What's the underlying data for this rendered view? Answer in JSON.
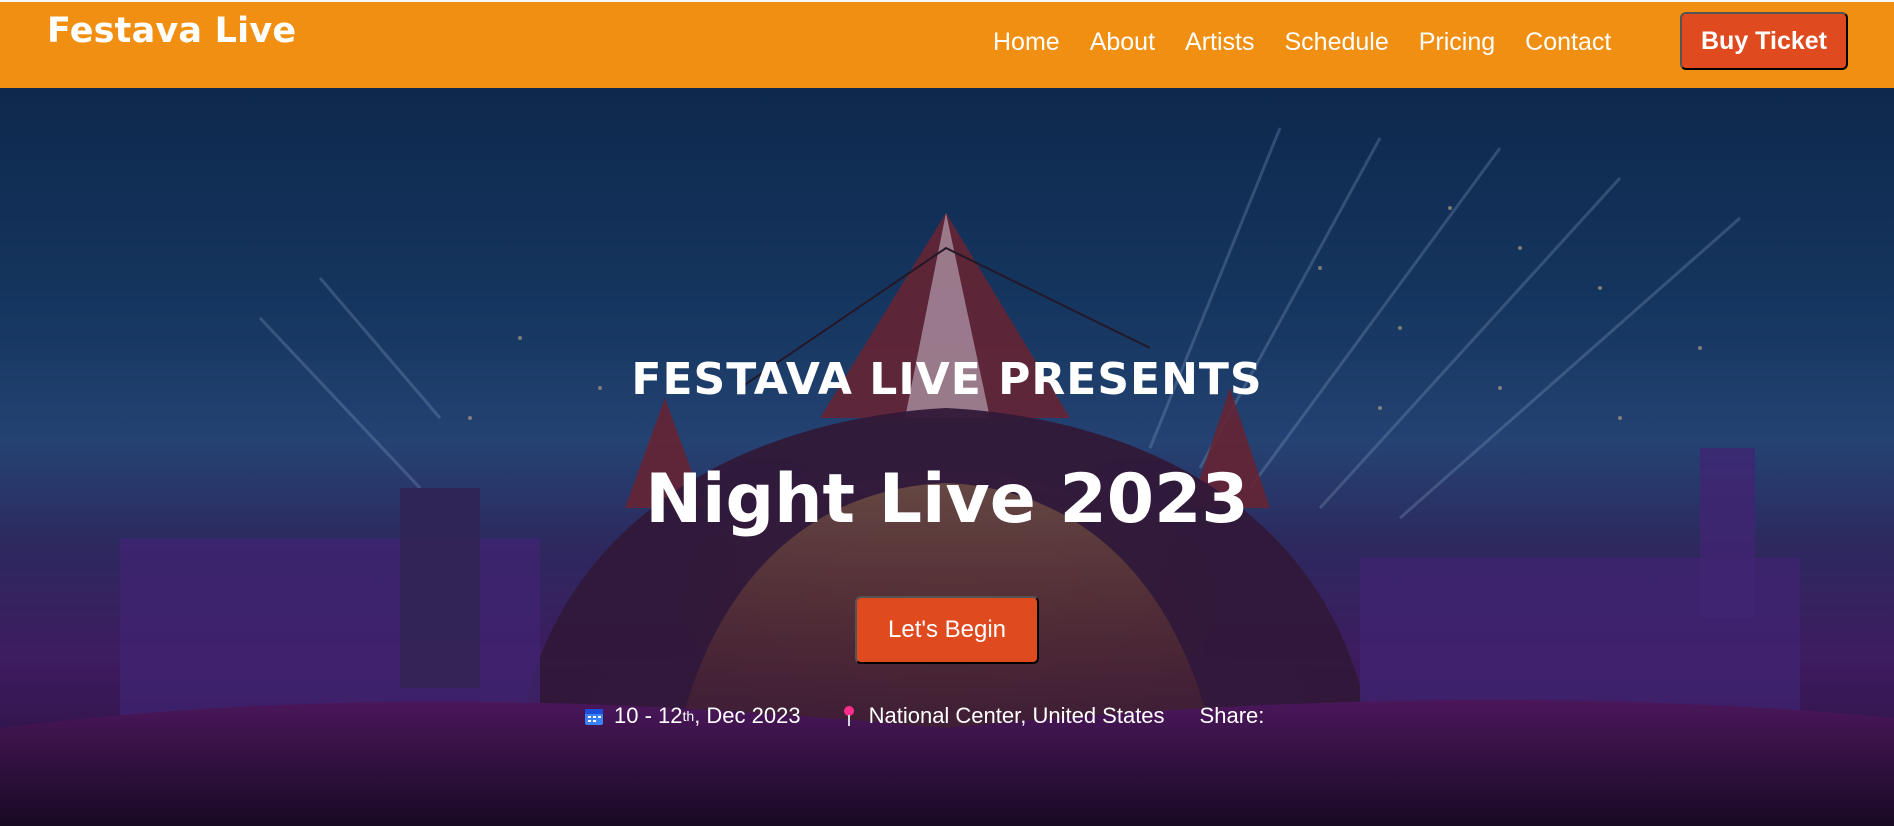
{
  "brand": {
    "name": "Festava Live"
  },
  "nav": {
    "items": [
      "Home",
      "About",
      "Artists",
      "Schedule",
      "Pricing",
      "Contact"
    ],
    "cta_label": "Buy Ticket"
  },
  "hero": {
    "kicker": "FESTAVA LIVE PRESENTS",
    "title": "Night Live 2023",
    "button_label": "Let's Begin",
    "date_prefix": "10 - 12",
    "date_sup": "th",
    "date_suffix": ", Dec 2023",
    "location": "National Center, United States",
    "share_label": "Share:"
  },
  "colors": {
    "navbar": "#f18f12",
    "button": "#e04a1f",
    "text": "#ffffff"
  },
  "icons": [
    "calendar-icon",
    "map-pin-icon"
  ]
}
